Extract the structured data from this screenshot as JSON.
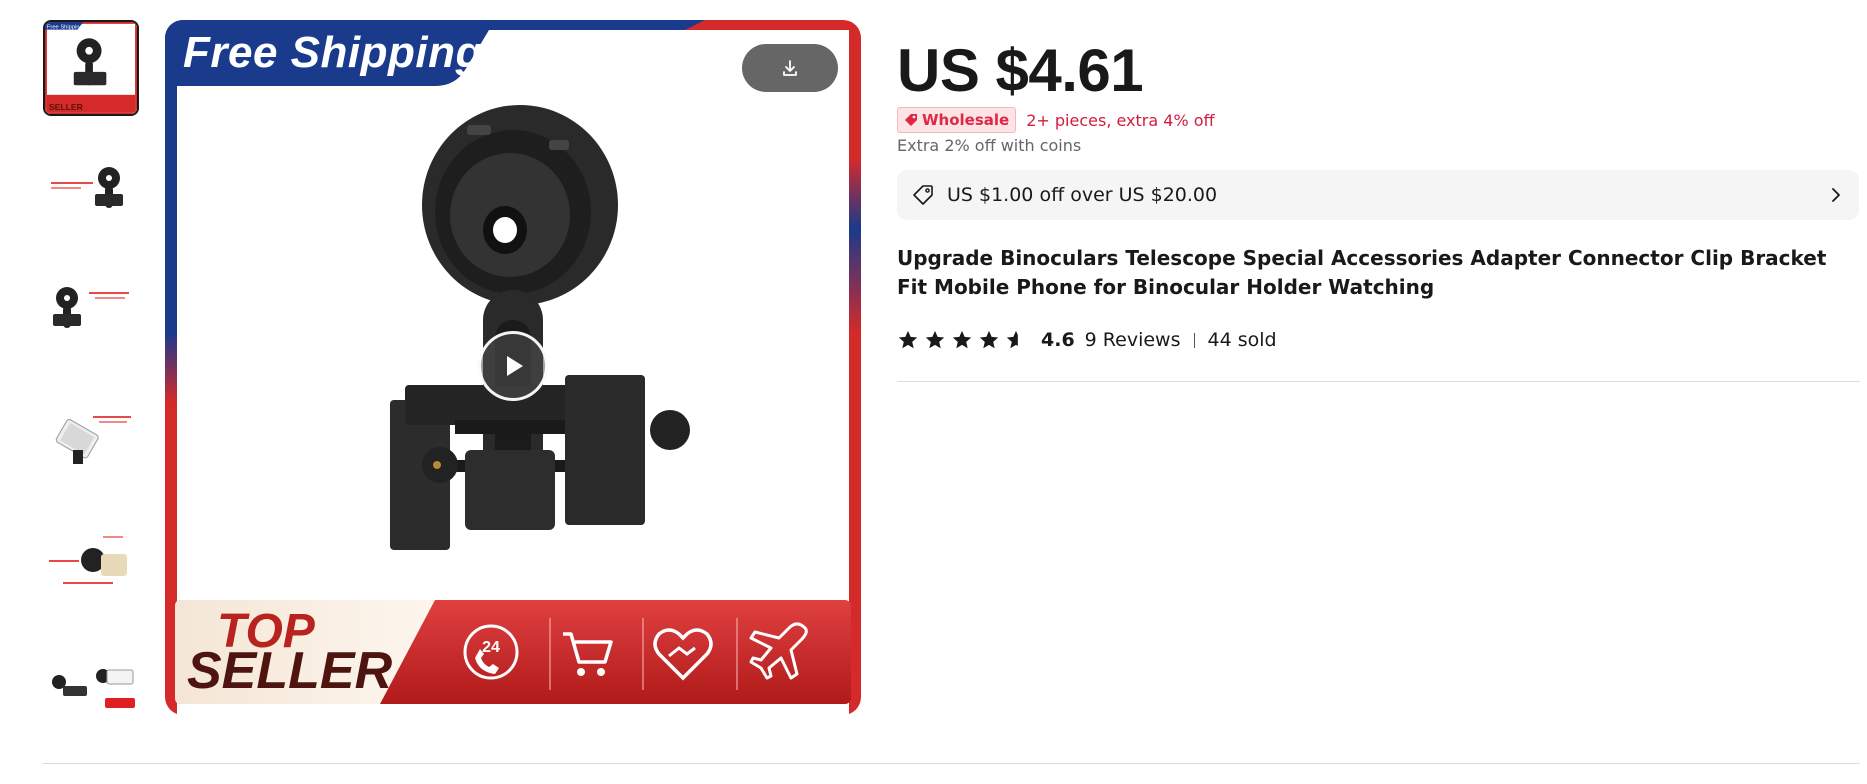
{
  "gallery": {
    "thumbnails": [
      {
        "label": "Free Shipping"
      },
      {
        "label": ""
      },
      {
        "label": ""
      },
      {
        "label": ""
      },
      {
        "label": ""
      },
      {
        "label": ""
      }
    ],
    "main_image": {
      "banner_text": "Free Shipping",
      "top_seller_line1": "TOP",
      "top_seller_line2": "SELLER",
      "badge_24": "24",
      "icons": [
        "phone-24-icon",
        "cart-icon",
        "handshake-heart-icon",
        "airplane-icon"
      ]
    }
  },
  "product": {
    "price": "US $4.61",
    "wholesale_badge": "Wholesale",
    "wholesale_text": "2+ pieces, extra 4% off",
    "coins_text": "Extra 2% off with coins",
    "coupon_text": "US $1.00 off over US $20.00",
    "title": "Upgrade Binoculars Telescope Special Accessories Adapter Connector Clip Bracket Fit Mobile Phone for Binocular Holder Watching",
    "rating": 4.6,
    "rating_label": "4.6",
    "reviews": "9 Reviews",
    "sold": "44 sold"
  },
  "colors": {
    "accent_red": "#e02846",
    "banner_blue": "#1a3a8c",
    "banner_red": "#d42a2a",
    "text": "#191919"
  }
}
